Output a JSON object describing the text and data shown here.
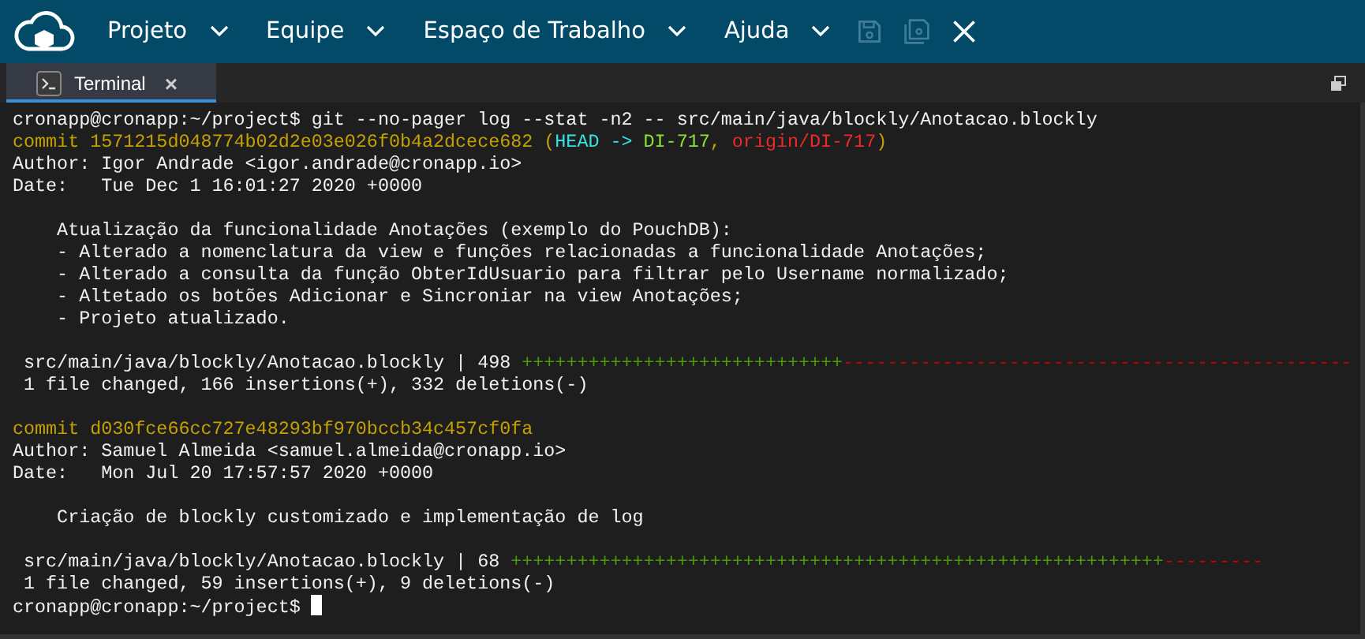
{
  "menu": [
    {
      "label": "Projeto"
    },
    {
      "label": "Equipe"
    },
    {
      "label": "Espaço de Trabalho"
    },
    {
      "label": "Ajuda"
    }
  ],
  "toolbar": [
    {
      "kind": "save",
      "disabled": true
    },
    {
      "kind": "save-all",
      "disabled": true
    },
    {
      "kind": "close",
      "disabled": false
    }
  ],
  "tabs": [
    {
      "label": "Terminal",
      "close": "×",
      "selected": true
    }
  ],
  "terminal": {
    "lines": [
      {
        "kind": "text",
        "segments": [
          {
            "kind": "plain",
            "text": "cronapp@cronapp:~/project$ git --no-pager log --stat -n2 -- src/main/java/blockly/Anotacao.blockly"
          }
        ]
      },
      {
        "kind": "text",
        "segments": [
          {
            "kind": "commit",
            "text": "commit 1571215d048774b02d2e03e026f0b4a2dcece682 ("
          },
          {
            "kind": "head",
            "text": "HEAD -> "
          },
          {
            "kind": "branch",
            "text": "DI-717"
          },
          {
            "kind": "commit",
            "text": ", "
          },
          {
            "kind": "remote",
            "text": "origin/DI-717"
          },
          {
            "kind": "commit",
            "text": ")"
          }
        ]
      },
      {
        "kind": "text",
        "segments": [
          {
            "kind": "plain",
            "text": "Author: Igor Andrade <igor.andrade@cronapp.io>"
          }
        ]
      },
      {
        "kind": "text",
        "segments": [
          {
            "kind": "plain",
            "text": "Date:   Tue Dec 1 16:01:27 2020 +0000"
          }
        ]
      },
      {
        "kind": "blank"
      },
      {
        "kind": "text",
        "segments": [
          {
            "kind": "plain",
            "text": "    Atualização da funcionalidade Anotações (exemplo do PouchDB):"
          }
        ]
      },
      {
        "kind": "text",
        "segments": [
          {
            "kind": "plain",
            "text": "    - Alterado a nomenclatura da view e funções relacionadas a funcionalidade Anotações;"
          }
        ]
      },
      {
        "kind": "text",
        "segments": [
          {
            "kind": "plain",
            "text": "    - Alterado a consulta da função ObterIdUsuario para filtrar pelo Username normalizado;"
          }
        ]
      },
      {
        "kind": "text",
        "segments": [
          {
            "kind": "plain",
            "text": "    - Altetado os botões Adicionar e Sincroniar na view Anotações;"
          }
        ]
      },
      {
        "kind": "text",
        "segments": [
          {
            "kind": "plain",
            "text": "    - Projeto atualizado."
          }
        ]
      },
      {
        "kind": "blank"
      },
      {
        "kind": "text",
        "segments": [
          {
            "kind": "plain",
            "text": " src/main/java/blockly/Anotacao.blockly | 498 "
          },
          {
            "kind": "plus",
            "text": "+++++++++++++++++++++++++++++"
          },
          {
            "kind": "minus",
            "text": "----------------------------------------------"
          }
        ]
      },
      {
        "kind": "text",
        "segments": [
          {
            "kind": "plain",
            "text": " 1 file changed, 166 insertions(+), 332 deletions(-)"
          }
        ]
      },
      {
        "kind": "blank"
      },
      {
        "kind": "text",
        "segments": [
          {
            "kind": "commit",
            "text": "commit d030fce66cc727e48293bf970bccb34c457cf0fa"
          }
        ]
      },
      {
        "kind": "text",
        "segments": [
          {
            "kind": "plain",
            "text": "Author: Samuel Almeida <samuel.almeida@cronapp.io>"
          }
        ]
      },
      {
        "kind": "text",
        "segments": [
          {
            "kind": "plain",
            "text": "Date:   Mon Jul 20 17:57:57 2020 +0000"
          }
        ]
      },
      {
        "kind": "blank"
      },
      {
        "kind": "text",
        "segments": [
          {
            "kind": "plain",
            "text": "    Criação de blockly customizado e implementação de log"
          }
        ]
      },
      {
        "kind": "blank"
      },
      {
        "kind": "text",
        "segments": [
          {
            "kind": "plain",
            "text": " src/main/java/blockly/Anotacao.blockly | 68 "
          },
          {
            "kind": "plus",
            "text": "+++++++++++++++++++++++++++++++++++++++++++++++++++++++++++"
          },
          {
            "kind": "minus",
            "text": "---------"
          }
        ]
      },
      {
        "kind": "text",
        "segments": [
          {
            "kind": "plain",
            "text": " 1 file changed, 59 insertions(+), 9 deletions(-)"
          }
        ]
      },
      {
        "kind": "text",
        "segments": [
          {
            "kind": "plain",
            "text": "cronapp@cronapp:~/project$ "
          },
          {
            "kind": "cursor"
          }
        ]
      }
    ]
  }
}
